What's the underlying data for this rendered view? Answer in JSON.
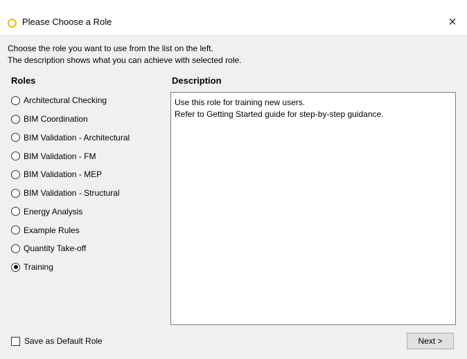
{
  "window": {
    "title": "Please Choose a Role",
    "close_label": "×",
    "accent_color": "#f2b705"
  },
  "intro": {
    "line1": "Choose the role you want to use from the list on the left.",
    "line2": "The description shows what you can achieve with selected role."
  },
  "roles": {
    "heading": "Roles",
    "selected": "Training",
    "items": [
      {
        "label": "Architectural Checking",
        "checked": false
      },
      {
        "label": "BIM Coordination",
        "checked": false
      },
      {
        "label": "BIM Validation - Architectural",
        "checked": false
      },
      {
        "label": "BIM Validation - FM",
        "checked": false
      },
      {
        "label": "BIM Validation - MEP",
        "checked": false
      },
      {
        "label": "BIM Validation - Structural",
        "checked": false
      },
      {
        "label": "Energy Analysis",
        "checked": false
      },
      {
        "label": "Example Rules",
        "checked": false
      },
      {
        "label": "Quantity Take-off",
        "checked": false
      },
      {
        "label": "Training",
        "checked": true
      }
    ]
  },
  "description": {
    "heading": "Description",
    "line1": "Use this role for training new users.",
    "line2": "Refer to Getting Started guide for step-by-step guidance."
  },
  "footer": {
    "save_default_label": "Save as Default Role",
    "save_default_checked": false,
    "next_label": "Next >"
  }
}
